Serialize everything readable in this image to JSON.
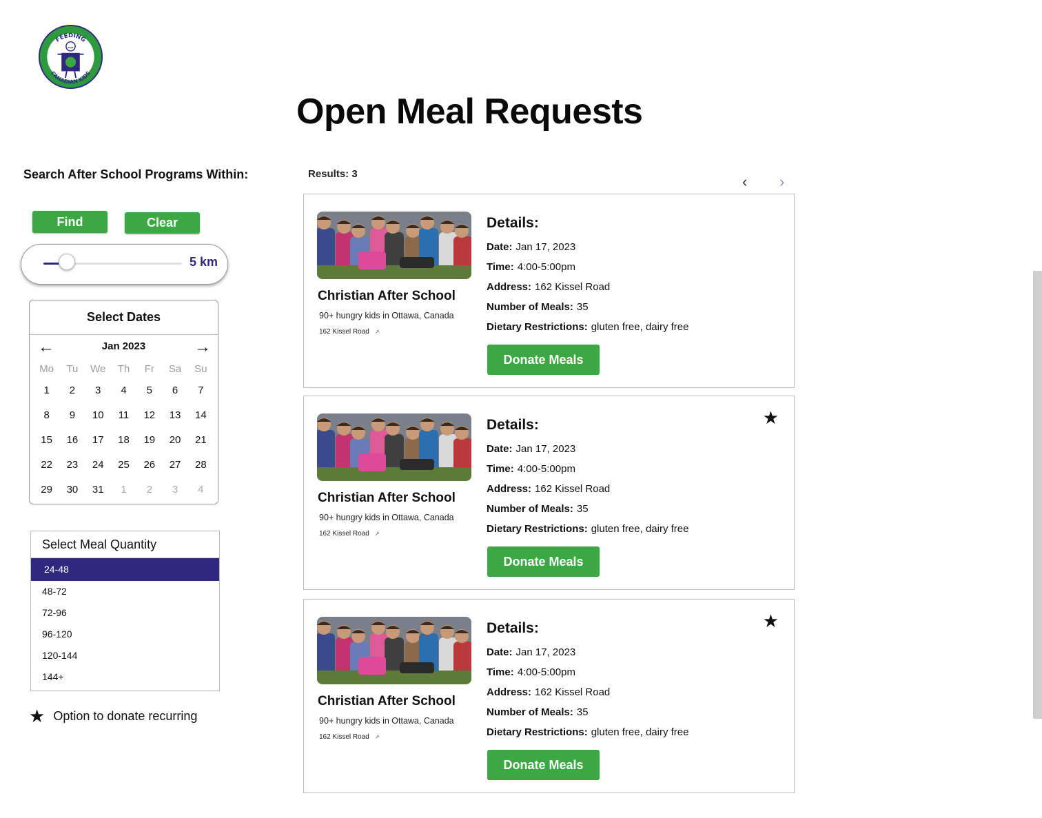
{
  "brand": {
    "logo_top_text": "FEEDING",
    "logo_bottom_text": "CANADIAN KIDS",
    "green": "#3ca844",
    "purple": "#2e2880"
  },
  "page_title": "Open Meal Requests",
  "search": {
    "label": "Search After School Programs Within:",
    "find_label": "Find",
    "clear_label": "Clear",
    "radius_value": 0.17,
    "radius_label": "5 km"
  },
  "calendar": {
    "title": "Select Dates",
    "month_label": "Jan 2023",
    "prev_icon": "arrow-left-icon",
    "next_icon": "arrow-right-icon",
    "weekdays": [
      "Mo",
      "Tu",
      "We",
      "Th",
      "Fr",
      "Sa",
      "Su"
    ],
    "weeks": [
      [
        "1",
        "2",
        "3",
        "4",
        "5",
        "6",
        "7"
      ],
      [
        "8",
        "9",
        "10",
        "11",
        "12",
        "13",
        "14"
      ],
      [
        "15",
        "16",
        "17",
        "18",
        "19",
        "20",
        "21"
      ],
      [
        "22",
        "23",
        "24",
        "25",
        "26",
        "27",
        "28"
      ],
      [
        "29",
        "30",
        "31",
        "1",
        "2",
        "3",
        "4"
      ]
    ],
    "muted_from_last_week_index": 3
  },
  "meal_quantity": {
    "title": "Select Meal Quantity",
    "options": [
      "24-48",
      "48-72",
      "72-96",
      "96-120",
      "120-144",
      "144+"
    ],
    "selected": "24-48"
  },
  "legend": {
    "icon": "star-icon",
    "text": "Option to donate recurring"
  },
  "results": {
    "count_label": "Results: 3",
    "prev_icon": "chevron-left-icon",
    "next_icon": "chevron-right-icon",
    "cards": [
      {
        "name": "Christian After School",
        "subtitle": "90+ hungry kids in Ottawa, Canada",
        "link": "162 Kissel Road",
        "details_title": "Details:",
        "date_label": "Date:",
        "date": "Jan 17, 2023",
        "time_label": "Time:",
        "time": "4:00-5:00pm",
        "address_label": "Address:",
        "address": "162 Kissel Road",
        "meals_label": "Number of Meals:",
        "meals": "35",
        "diet_label": "Dietary Restrictions:",
        "diet": "gluten free, dairy free",
        "button": "Donate Meals",
        "recurring": false
      },
      {
        "name": "Christian After School",
        "subtitle": "90+ hungry kids in Ottawa, Canada",
        "link": "162 Kissel Road",
        "details_title": "Details:",
        "date_label": "Date:",
        "date": "Jan 17, 2023",
        "time_label": "Time:",
        "time": "4:00-5:00pm",
        "address_label": "Address:",
        "address": "162 Kissel Road",
        "meals_label": "Number of Meals:",
        "meals": "35",
        "diet_label": "Dietary Restrictions:",
        "diet": "gluten free, dairy free",
        "button": "Donate Meals",
        "recurring": true
      },
      {
        "name": "Christian After School",
        "subtitle": "90+ hungry kids in Ottawa, Canada",
        "link": "162 Kissel Road",
        "details_title": "Details:",
        "date_label": "Date:",
        "date": "Jan 17, 2023",
        "time_label": "Time:",
        "time": "4:00-5:00pm",
        "address_label": "Address:",
        "address": "162 Kissel Road",
        "meals_label": "Number of Meals:",
        "meals": "35",
        "diet_label": "Dietary Restrictions:",
        "diet": "gluten free, dairy free",
        "button": "Donate Meals",
        "recurring": true
      }
    ]
  }
}
